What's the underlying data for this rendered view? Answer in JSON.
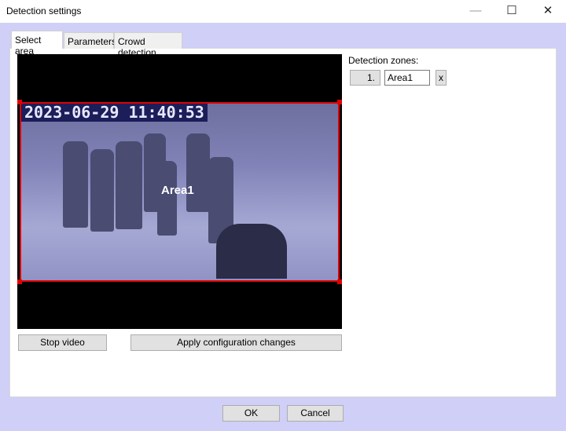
{
  "window": {
    "title": "Detection settings",
    "minimize": "—",
    "maximize": "☐",
    "close": "✕"
  },
  "tabs": [
    {
      "label": "Select area",
      "active": true
    },
    {
      "label": "Parameters"
    },
    {
      "label": "Crowd detection"
    }
  ],
  "video": {
    "timestamp": "2023-06-29 11:40:53",
    "zone_label": "Area1",
    "zone_color": "#e00000"
  },
  "zones": {
    "label": "Detection zones:",
    "items": [
      {
        "index": "1.",
        "name": "Area1",
        "remove": "x"
      }
    ]
  },
  "buttons": {
    "stop_video": "Stop video",
    "apply": "Apply configuration changes",
    "ok": "OK",
    "cancel": "Cancel"
  }
}
